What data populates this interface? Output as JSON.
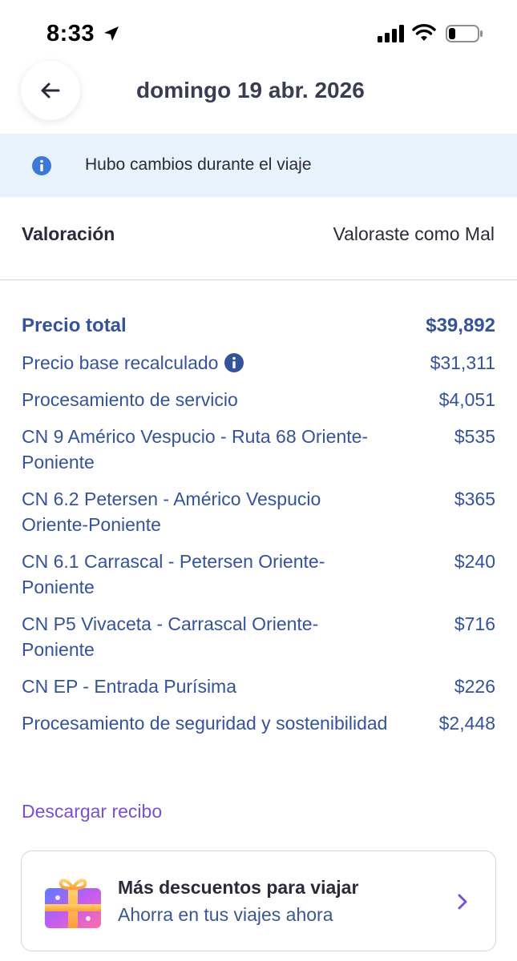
{
  "status_bar": {
    "time": "8:33"
  },
  "header": {
    "title": "domingo 19 abr. 2026"
  },
  "info_banner": {
    "text": "Hubo cambios durante el viaje"
  },
  "rating": {
    "label": "Valoración",
    "value": "Valoraste como Mal"
  },
  "price": {
    "items": [
      {
        "label": "Precio total",
        "value": "$39,892"
      },
      {
        "label": "Precio base recalculado",
        "value": "$31,311"
      },
      {
        "label": "Procesamiento de servicio",
        "value": "$4,051"
      },
      {
        "label": "CN 9 Américo Vespucio - Ruta 68 Oriente-Poniente",
        "value": "$535"
      },
      {
        "label": "CN 6.2 Petersen - Américo Vespucio Oriente-Poniente",
        "value": "$365"
      },
      {
        "label": "CN 6.1 Carrascal - Petersen Oriente-Poniente",
        "value": "$240"
      },
      {
        "label": "CN P5 Vivaceta - Carrascal Oriente-Poniente",
        "value": "$716"
      },
      {
        "label": "CN EP - Entrada Purísima",
        "value": "$226"
      },
      {
        "label": "Procesamiento de seguridad y sostenibilidad",
        "value": "$2,448"
      }
    ]
  },
  "download": {
    "label": "Descargar recibo"
  },
  "promo": {
    "title": "Más descuentos para viajar",
    "subtitle": "Ahorra en tus viajes ahora",
    "icon": "gift-ticket-icon"
  },
  "colors": {
    "accent_blue": "#34539a",
    "link_purple": "#7b4fd1",
    "banner_bg": "#e8f2fc",
    "info_icon": "#3b78d8"
  }
}
